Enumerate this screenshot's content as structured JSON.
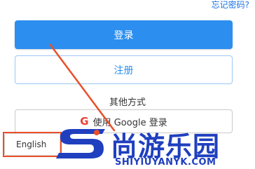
{
  "links": {
    "forgot_password": "忘记密码?"
  },
  "buttons": {
    "login": "登录",
    "register": "注册"
  },
  "other_methods": {
    "label": "其他方式",
    "google_login": "使用 Google 登录",
    "google_icon": "G"
  },
  "language": {
    "selected": "English"
  },
  "watermark": {
    "brand": "尚游乐园",
    "domain": "SHIYIUYANYK.COM"
  },
  "colors": {
    "primary": "#2c8ff0",
    "link": "#1a73e8",
    "annotation": "#e8502a",
    "watermark": "#1f3fbf"
  }
}
